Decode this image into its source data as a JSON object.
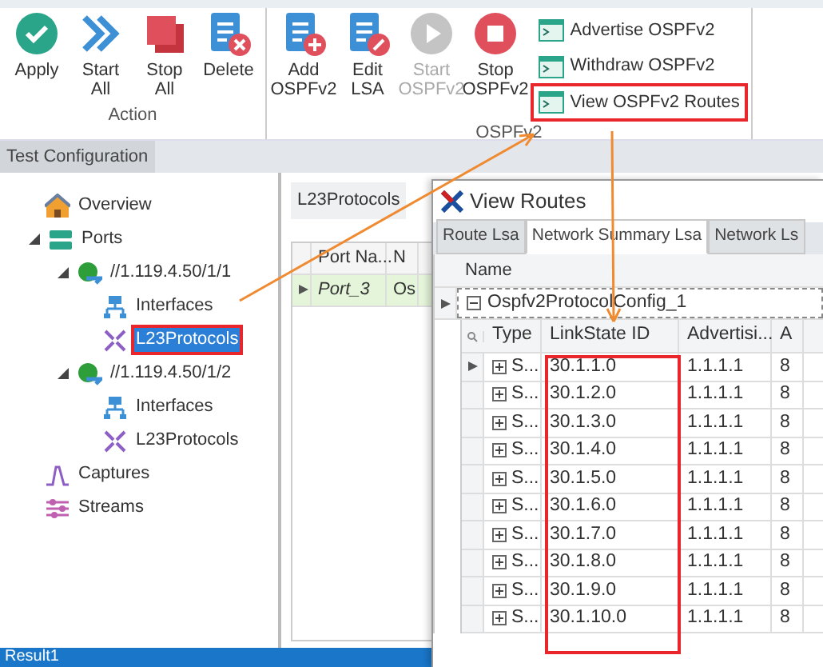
{
  "toolbar": {
    "groups": [
      {
        "label": "Action",
        "buttons": [
          {
            "label": "Apply",
            "disabled": false
          },
          {
            "label": "Start All",
            "disabled": false
          },
          {
            "label": "Stop All",
            "disabled": false
          },
          {
            "label": "Delete",
            "disabled": false
          }
        ]
      },
      {
        "label": "OSPFv2",
        "buttons": [
          {
            "label": "Add OSPFv2",
            "disabled": false
          },
          {
            "label": "Edit LSA",
            "disabled": false
          },
          {
            "label": "Start OSPFv2",
            "disabled": true
          },
          {
            "label": "Stop OSPFv2",
            "disabled": false
          }
        ],
        "small_buttons": [
          {
            "label": "Advertise OSPFv2",
            "highlighted": false
          },
          {
            "label": "Withdraw OSPFv2",
            "highlighted": false
          },
          {
            "label": "View OSPFv2 Routes",
            "highlighted": true
          }
        ]
      }
    ]
  },
  "doc_tab": {
    "label": "Test Configuration"
  },
  "tree": [
    {
      "label": "Overview",
      "kind": "overview",
      "selected": false,
      "highlighted": false
    },
    {
      "label": "Ports",
      "kind": "ports",
      "expanded": true,
      "selected": false,
      "highlighted": false,
      "children": [
        {
          "label": "//1.119.4.50/1/1",
          "kind": "port",
          "expanded": true,
          "selected": false,
          "highlighted": false,
          "children": [
            {
              "label": "Interfaces",
              "kind": "interfaces",
              "selected": false,
              "highlighted": false
            },
            {
              "label": "L23Protocols",
              "kind": "protocols",
              "selected": true,
              "highlighted": true
            }
          ]
        },
        {
          "label": "//1.119.4.50/1/2",
          "kind": "port",
          "expanded": true,
          "selected": false,
          "highlighted": false,
          "children": [
            {
              "label": "Interfaces",
              "kind": "interfaces",
              "selected": false,
              "highlighted": false
            },
            {
              "label": "L23Protocols",
              "kind": "protocols",
              "selected": false,
              "highlighted": false
            }
          ]
        }
      ]
    },
    {
      "label": "Captures",
      "kind": "captures",
      "selected": false,
      "highlighted": false
    },
    {
      "label": "Streams",
      "kind": "streams",
      "selected": false,
      "highlighted": false
    }
  ],
  "middle_panel": {
    "tab": "L23Protocols",
    "columns": [
      "Port Na...",
      "N"
    ],
    "rows": [
      {
        "cells": [
          "Port_3",
          "Os"
        ],
        "selected": true
      }
    ]
  },
  "view_routes": {
    "title": "View Routes",
    "tabs": [
      {
        "label": "Route Lsa",
        "selected": false
      },
      {
        "label": "Network Summary Lsa",
        "selected": true
      },
      {
        "label": "Network Ls",
        "selected": false
      }
    ],
    "outer_column": "Name",
    "group": "Ospfv2ProtocolConfig_1",
    "columns": [
      {
        "label": "Type",
        "highlighted": false
      },
      {
        "label": "LinkState ID",
        "highlighted": true
      },
      {
        "label": "Advertisi...",
        "highlighted": false
      },
      {
        "label": "A",
        "highlighted": false
      }
    ],
    "rows": [
      [
        "S...",
        "30.1.1.0",
        "1.1.1.1",
        "8"
      ],
      [
        "S...",
        "30.1.2.0",
        "1.1.1.1",
        "8"
      ],
      [
        "S...",
        "30.1.3.0",
        "1.1.1.1",
        "8"
      ],
      [
        "S...",
        "30.1.4.0",
        "1.1.1.1",
        "8"
      ],
      [
        "S...",
        "30.1.5.0",
        "1.1.1.1",
        "8"
      ],
      [
        "S...",
        "30.1.6.0",
        "1.1.1.1",
        "8"
      ],
      [
        "S...",
        "30.1.7.0",
        "1.1.1.1",
        "8"
      ],
      [
        "S...",
        "30.1.8.0",
        "1.1.1.1",
        "8"
      ],
      [
        "S...",
        "30.1.9.0",
        "1.1.1.1",
        "8"
      ],
      [
        "S...",
        "30.1.10.0",
        "1.1.1.1",
        "8"
      ]
    ]
  },
  "status_bar": {
    "label": "Result1"
  }
}
